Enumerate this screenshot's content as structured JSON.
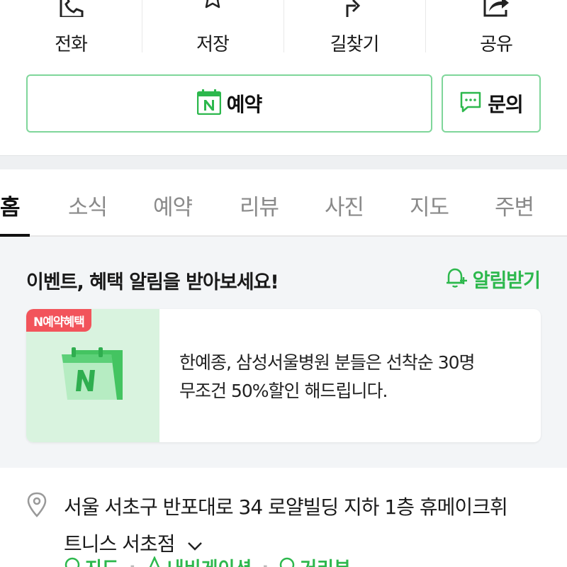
{
  "colors": {
    "accent": "#2db84d",
    "border_green": "#7fd69a",
    "badge_red": "#f2545b",
    "section_bg": "#f3f5f7"
  },
  "actions": [
    {
      "label": "전화",
      "icon": "phone-icon"
    },
    {
      "label": "저장",
      "icon": "star-icon"
    },
    {
      "label": "길찾기",
      "icon": "directions-icon"
    },
    {
      "label": "공유",
      "icon": "share-icon"
    }
  ],
  "buttons": {
    "reserve_label": "예약",
    "reserve_icon": "naver-booking-icon",
    "inquiry_label": "문의",
    "inquiry_icon": "chat-bubble-icon"
  },
  "tabs": [
    {
      "label": "홈",
      "active": true
    },
    {
      "label": "소식",
      "active": false
    },
    {
      "label": "예약",
      "active": false
    },
    {
      "label": "리뷰",
      "active": false
    },
    {
      "label": "사진",
      "active": false
    },
    {
      "label": "지도",
      "active": false
    },
    {
      "label": "주변",
      "active": false
    }
  ],
  "event": {
    "title": "이벤트, 혜택 알림을 받아보세요!",
    "alarm_label": "알림받기",
    "alarm_icon": "bell-plus-icon",
    "card": {
      "badge": "N예약혜택",
      "image_icon": "naver-calendar-icon",
      "text_line1": "한예종, 삼성서울병원 분들은 선착순 30명",
      "text_line2": "무조건 50%할인 해드립니다."
    }
  },
  "address": {
    "icon": "location-pin-icon",
    "line1": "서울 서초구 반포대로 34 로얄빌딩 지하 1층 휴메이크휘",
    "line2": "트니스 서초점",
    "links": [
      "지도",
      "내비게이션",
      "거리뷰"
    ]
  }
}
